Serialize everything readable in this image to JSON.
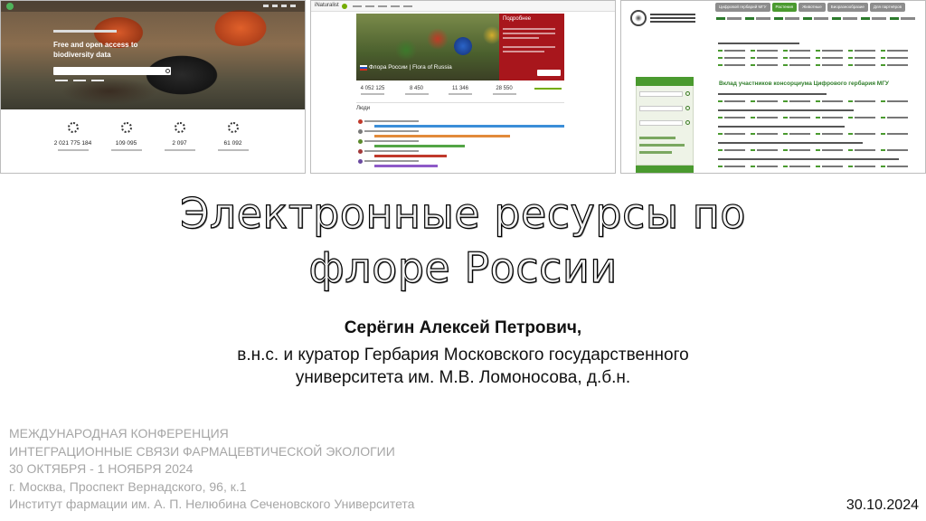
{
  "thumbnails": {
    "gbif": {
      "hero_title": "Free and open access to biodiversity data",
      "stats": [
        "2 021 775 184",
        "109 095",
        "2 097",
        "61 092"
      ]
    },
    "inaturalist": {
      "logo": "iNaturalist",
      "banner_caption": "Флора России | Flora of Russia",
      "panel_title": "Подробнее",
      "stats": [
        "4 052 125",
        "8 450",
        "11 346",
        "28 550"
      ],
      "section_label": "Люди"
    },
    "msu": {
      "tabs": [
        "Цифровой гербарий МГУ",
        "Растения",
        "Животные",
        "Биоразнообразие",
        "Для партнёров"
      ],
      "active_tab": 1,
      "main_title": "Вклад участников консорциума Цифрового гербария МГУ"
    }
  },
  "slide": {
    "title_line1": "Электронные ресурсы по",
    "title_line2": "флоре России",
    "author": "Серёгин Алексей Петрович,",
    "position_line1": "в.н.с. и куратор Гербария Московского государственного",
    "position_line2": "университета им. М.В. Ломоносова, д.б.н.",
    "conference": [
      "МЕЖДУНАРОДНАЯ КОНФЕРЕНЦИЯ",
      "ИНТЕГРАЦИОННЫЕ СВЯЗИ ФАРМАЦЕВТИЧЕСКОЙ ЭКОЛОГИИ",
      "30 ОКТЯБРЯ - 1 НОЯБРЯ 2024",
      "г. Москва, Проспект Вернадского, 96, к.1",
      "Институт фармации им. А. П. Нелюбина Сеченовского Университета"
    ],
    "date": "30.10.2024"
  },
  "colors": {
    "msu_green": "#4a9a2f",
    "inat_green": "#74ac00",
    "inat_red": "#a8161c",
    "conference_grey": "#a6a6a6"
  }
}
